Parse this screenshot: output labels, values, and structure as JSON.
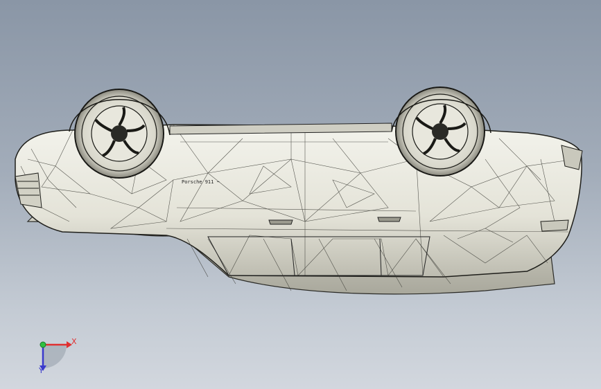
{
  "viewport": {
    "background_top": "#8a96a6",
    "background_bottom": "#d2d7de",
    "model": "car-body-mesh",
    "view": "underside-wireframe",
    "emblem_text": "Porsche 911 ~"
  },
  "triad": {
    "x_label": "X",
    "y_label": "Y",
    "colors": {
      "x": "#e03030",
      "y": "#30c040",
      "z": "#3a3acc"
    }
  }
}
